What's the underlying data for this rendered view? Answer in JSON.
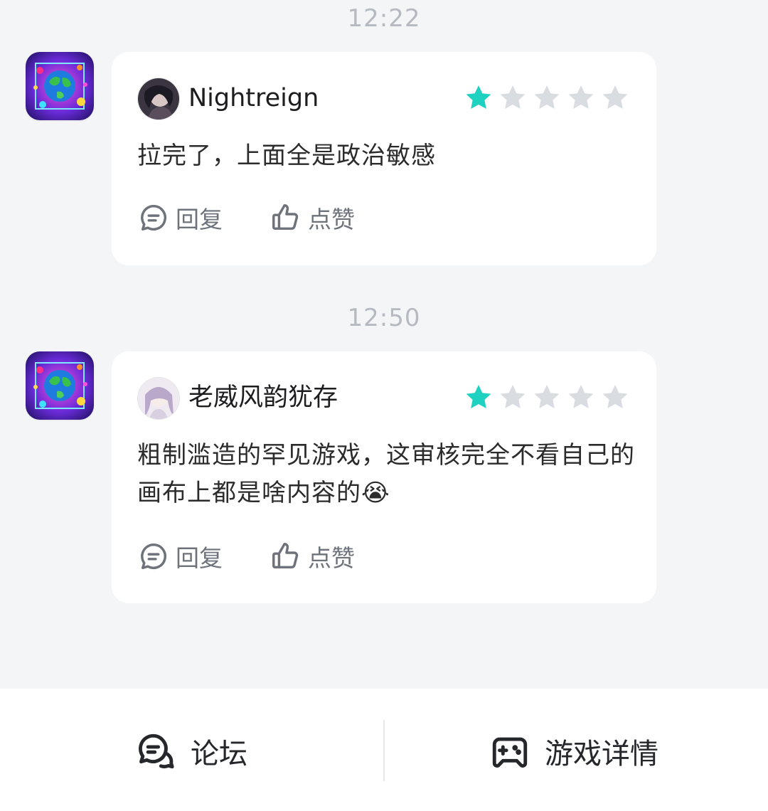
{
  "messages": [
    {
      "time": "12:22",
      "username": "Nightreign",
      "rating": 1,
      "max_rating": 5,
      "text": "拉完了，上面全是政治敏感",
      "reply_label": "回复",
      "like_label": "点赞"
    },
    {
      "time": "12:50",
      "username": "老威风韵犹存",
      "rating": 1,
      "max_rating": 5,
      "text": "粗制滥造的罕见游戏，这审核完全不看自己的画布上都是啥内容的😭",
      "reply_label": "回复",
      "like_label": "点赞"
    }
  ],
  "bottom_nav": {
    "forum_label": "论坛",
    "game_details_label": "游戏详情"
  },
  "colors": {
    "star_active": "#1fd1c1",
    "star_inactive": "#d9dde2",
    "background": "#f4f5f7",
    "card": "#ffffff"
  },
  "icons": {
    "reply": "comment-bubble-icon",
    "like": "thumbs-up-icon",
    "forum": "chat-bubbles-icon",
    "game_details": "gamepad-icon",
    "game_app": "globe-art-app-icon"
  }
}
